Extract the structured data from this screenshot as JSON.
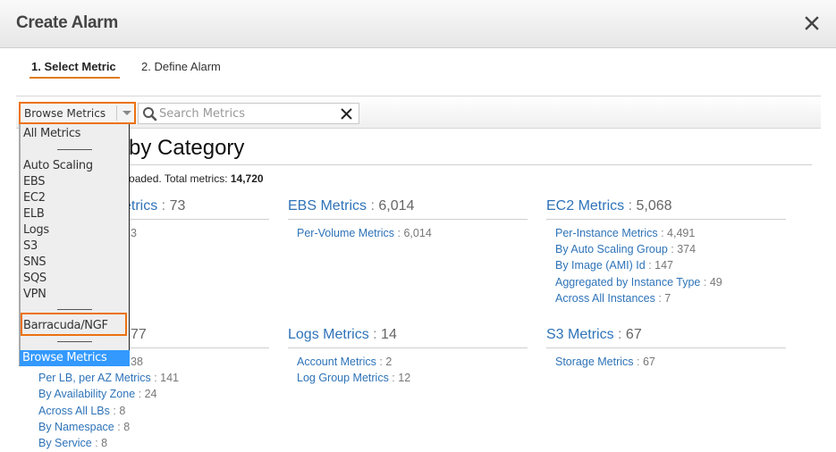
{
  "dialog": {
    "title": "Create Alarm",
    "close_icon": "close-icon"
  },
  "wizard": {
    "steps": [
      {
        "label": "1. Select Metric",
        "active": true
      },
      {
        "label": "2. Define Alarm",
        "active": false
      }
    ]
  },
  "toolbar": {
    "browse_select": {
      "value": "Browse Metrics",
      "icon": "chevron-down-icon"
    },
    "search": {
      "placeholder": "Search Metrics",
      "value": "",
      "icon": "search-icon",
      "clear_icon": "clear-icon"
    }
  },
  "dropdown": {
    "options": [
      {
        "label": "All Metrics"
      },
      {
        "separator": true
      },
      {
        "label": "Auto Scaling"
      },
      {
        "label": "EBS"
      },
      {
        "label": "EC2"
      },
      {
        "label": "ELB"
      },
      {
        "label": "Logs"
      },
      {
        "label": "S3"
      },
      {
        "label": "SNS"
      },
      {
        "label": "SQS"
      },
      {
        "label": "VPN"
      },
      {
        "separator": true
      },
      {
        "label": "Barracuda/NGF",
        "highlighted": true
      },
      {
        "separator": true
      },
      {
        "label": "Browse Metrics",
        "selected": true
      }
    ],
    "highlight_color": "#ec7211",
    "selected_color": "#3399ff"
  },
  "main": {
    "title_visible": "h Metrics by Category",
    "summary_prefix": "etric summary has loaded. Total metrics: ",
    "total_metrics": "14,720",
    "categories": [
      {
        "name": "etrics",
        "count": "73",
        "items": [
          {
            "name": "",
            "count": "3"
          }
        ]
      },
      {
        "name": "EBS Metrics",
        "count": "6,014",
        "items": [
          {
            "name": "Per-Volume Metrics",
            "count": "6,014"
          }
        ]
      },
      {
        "name": "EC2 Metrics",
        "count": "5,068",
        "items": [
          {
            "name": "Per-Instance Metrics",
            "count": "4,491"
          },
          {
            "name": "By Auto Scaling Group",
            "count": "374"
          },
          {
            "name": "By Image (AMI) Id",
            "count": "147"
          },
          {
            "name": "Aggregated by Instance Type",
            "count": "49"
          },
          {
            "name": "Across All Instances",
            "count": "7"
          }
        ]
      },
      {
        "name": "",
        "count": "77",
        "items": [
          {
            "name": "",
            "count": "38"
          },
          {
            "name": "Per LB, per AZ Metrics",
            "count": "141"
          },
          {
            "name": "By Availability Zone",
            "count": "24"
          },
          {
            "name": "Across All LBs",
            "count": "8"
          },
          {
            "name": "By Namespace",
            "count": "8"
          },
          {
            "name": "By Service",
            "count": "8"
          }
        ]
      },
      {
        "name": "Logs Metrics",
        "count": "14",
        "items": [
          {
            "name": "Account Metrics",
            "count": "2"
          },
          {
            "name": "Log Group Metrics",
            "count": "12"
          }
        ]
      },
      {
        "name": "S3 Metrics",
        "count": "67",
        "items": [
          {
            "name": "Storage Metrics",
            "count": "67"
          }
        ]
      }
    ]
  },
  "colors": {
    "accent": "#ec7211",
    "link": "#2e73b8",
    "tab_underline": "#e07b14"
  }
}
